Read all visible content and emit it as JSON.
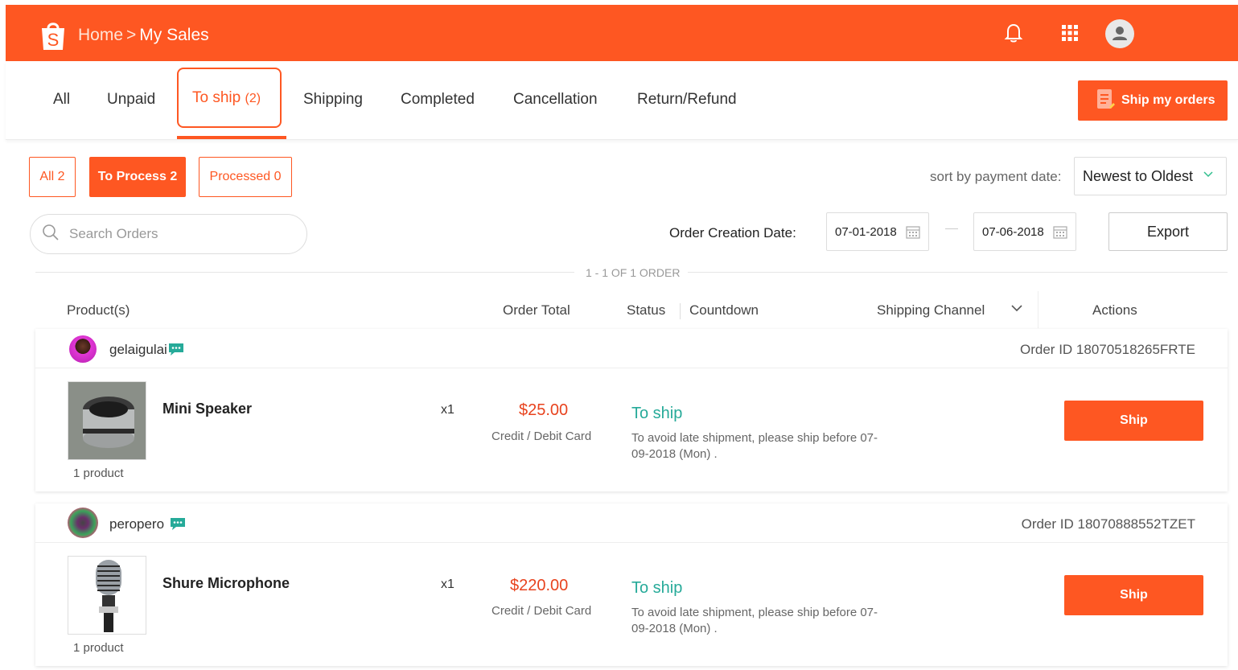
{
  "header": {
    "breadcrumb_home": "Home",
    "breadcrumb_sep": ">",
    "breadcrumb_current": "My Sales",
    "icons": [
      "shopee-bag-icon",
      "bell-icon",
      "apps-grid-icon",
      "user-avatar-icon"
    ],
    "brand_color": "#fe5722"
  },
  "tabs": [
    {
      "label": "All"
    },
    {
      "label": "Unpaid"
    },
    {
      "label": "To ship",
      "count": "(2)"
    },
    {
      "label": "Shipping"
    },
    {
      "label": "Completed"
    },
    {
      "label": "Cancellation"
    },
    {
      "label": "Return/Refund"
    }
  ],
  "active_tab": "To ship",
  "ship_my_orders_label": "Ship my orders",
  "filters": {
    "all_label": "All",
    "all_count": "2",
    "to_process_label": "To Process",
    "to_process_count": "2",
    "processed_label": "Processed",
    "processed_count": "0",
    "sort_label": "sort by payment date:",
    "sort_value": "Newest to Oldest",
    "search_placeholder": "Search Orders",
    "creation_date_label": "Order Creation Date:",
    "date_from": "07-01-2018",
    "date_to": "07-06-2018",
    "export_label": "Export"
  },
  "count_text": "1 - 1 OF 1 ORDER",
  "table_headers": {
    "products": "Product(s)",
    "order_total": "Order Total",
    "status": "Status",
    "countdown": "Countdown",
    "shipping_channel": "Shipping Channel",
    "actions": "Actions"
  },
  "orders": [
    {
      "buyer": "gelaigulai",
      "order_id": "Order ID 18070518265FRTE",
      "product_name": "Mini Speaker",
      "product_count": "1 product",
      "qty": "x1",
      "total": "$25.00",
      "payment": "Credit / Debit Card",
      "status": "To ship",
      "note": "To avoid late shipment, please ship before 07-09-2018 (Mon) .",
      "action": "Ship"
    },
    {
      "buyer": "peropero",
      "order_id": "Order ID 18070888552TZET",
      "product_name": "Shure Microphone",
      "product_count": "1 product",
      "qty": "x1",
      "total": "$220.00",
      "payment": "Credit / Debit Card",
      "status": "To ship",
      "note": "To avoid late shipment, please ship before 07-09-2018 (Mon) .",
      "action": "Ship"
    }
  ]
}
